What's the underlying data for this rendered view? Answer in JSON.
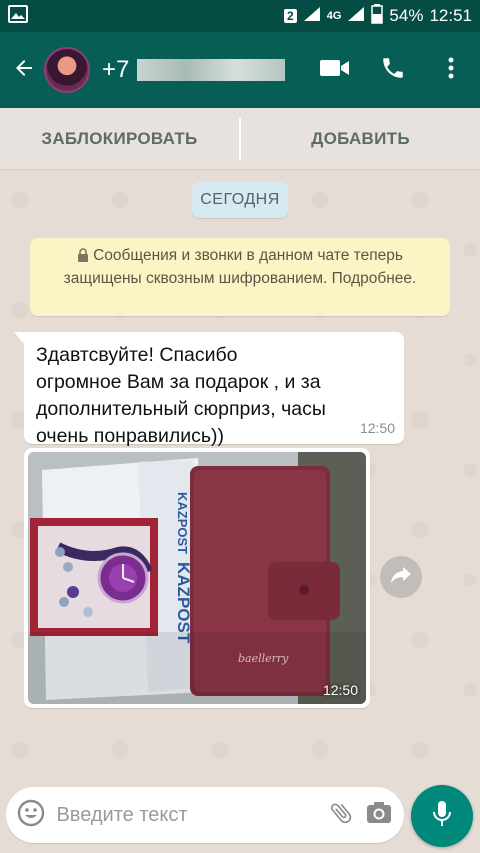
{
  "status_bar": {
    "sim_slot": "2",
    "network_type": "4G",
    "battery": "54%",
    "time": "12:51"
  },
  "header": {
    "contact_number": "+7",
    "icons": [
      "back-arrow-icon",
      "video-call-icon",
      "phone-icon",
      "more-vert-icon"
    ]
  },
  "contact_actions": {
    "block_label": "ЗАБЛОКИРОВАТЬ",
    "add_label": "ДОБАВИТЬ"
  },
  "chat": {
    "date_label": "СЕГОДНЯ",
    "encryption_notice": "Сообщения и звонки в данном чате теперь защищены сквозным шифрованием. Подробнее.",
    "messages": [
      {
        "type": "text",
        "text": "Здавтсвуйте! Спасибо\nогромное Вам за подарок , и за\nдополнительный  сюрприз, часы\nочень понравились))",
        "time": "12:50"
      },
      {
        "type": "image",
        "time": "12:50",
        "image_labels": [
          "KAZPOST",
          "baellerry"
        ]
      }
    ]
  },
  "composer": {
    "placeholder": "Введите текст"
  },
  "colors": {
    "status_bar": "#054d44",
    "app_bar": "#075e54",
    "accent": "#00897b",
    "chat_bg": "#e5ddd5",
    "notice_bg": "#fdf4c5",
    "date_chip_bg": "#d7eaf4"
  }
}
